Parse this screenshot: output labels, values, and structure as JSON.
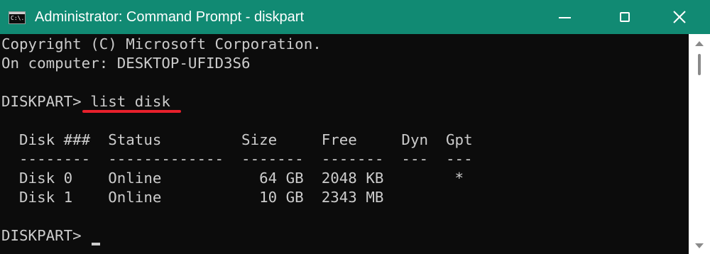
{
  "window": {
    "title": "Administrator: Command Prompt - diskpart",
    "icon": "cmd-app-icon",
    "icon_text": "C:\\.",
    "title_bar_color": "#118a73",
    "controls": {
      "minimize_icon": "minimize-icon",
      "maximize_icon": "maximize-icon",
      "close_icon": "close-icon"
    }
  },
  "console": {
    "background": "#0c0c0c",
    "foreground": "#cccccc",
    "highlight_color": "#e8202c",
    "lines": [
      "Copyright (C) Microsoft Corporation.",
      "On computer: DESKTOP-UFID3S6",
      "",
      "DISKPART> list disk",
      "",
      "  Disk ###  Status         Size     Free     Dyn  Gpt",
      "  --------  -------------  -------  -------  ---  ---",
      "  Disk 0    Online           64 GB  2048 KB        *",
      "  Disk 1    Online           10 GB  2343 MB",
      "",
      "DISKPART> "
    ],
    "highlighted_command": "list disk",
    "table": {
      "columns": [
        "Disk ###",
        "Status",
        "Size",
        "Free",
        "Dyn",
        "Gpt"
      ],
      "rows": [
        [
          "Disk 0",
          "Online",
          "64 GB",
          "2048 KB",
          "",
          "*"
        ],
        [
          "Disk 1",
          "Online",
          "10 GB",
          "2343 MB",
          "",
          ""
        ]
      ]
    }
  }
}
